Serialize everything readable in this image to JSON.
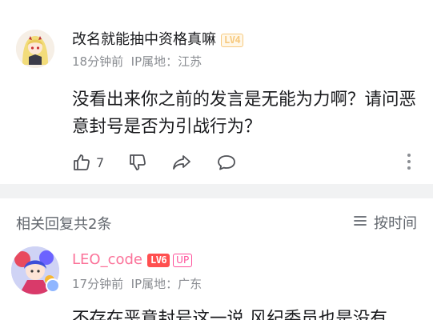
{
  "comment": {
    "username": "改名就能抽中资格真嘛",
    "level_badge": "LV4",
    "time": "18分钟前",
    "ip_location": "IP属地：江苏",
    "text": "没看出来你之前的发言是无能为力啊？请问恶意封号是否为引战行为？",
    "like_count": "7",
    "icons": [
      "thumb-up-icon",
      "thumb-down-icon",
      "share-icon",
      "comment-icon",
      "more-vertical-icon"
    ]
  },
  "replies_section": {
    "title": "相关回复共2条",
    "sort_label": "按时间",
    "sort_icon": "sort-lines-icon"
  },
  "reply": {
    "username": "LEO_code",
    "level_badge": "LV6",
    "up_badge": "UP",
    "time": "17分钟前",
    "ip_location": "IP属地：广东",
    "text_visible": "不存在恶意封号这一说 风纪委员也是没有",
    "username_color": "#fb7299"
  },
  "colors": {
    "text": "#18191c",
    "meta": "#8a8d92",
    "divider": "#f1f2f3",
    "level4": "#f7c97e",
    "level6": "#ff4f4f",
    "up": "#ff4f9a"
  }
}
